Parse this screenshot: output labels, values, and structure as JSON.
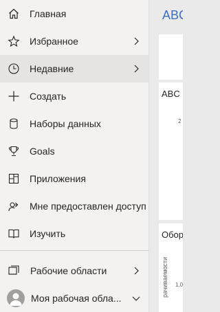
{
  "nav": {
    "items": [
      {
        "label": "Главная",
        "icon": "home-icon"
      },
      {
        "label": "Избранное",
        "icon": "star-icon",
        "has_chevron": true
      },
      {
        "label": "Недавние",
        "icon": "clock-icon",
        "has_chevron": true,
        "active": true
      },
      {
        "label": "Создать",
        "icon": "plus-icon"
      },
      {
        "label": "Наборы данных",
        "icon": "database-icon"
      },
      {
        "label": "Goals",
        "icon": "trophy-icon"
      },
      {
        "label": "Приложения",
        "icon": "apps-icon"
      },
      {
        "label": "Мне предоставлен доступ",
        "icon": "shared-with-me-icon"
      },
      {
        "label": "Изучить",
        "icon": "book-icon"
      }
    ],
    "workspaces_label": "Рабочие области",
    "my_workspace_label": "Моя рабочая обла..."
  },
  "content": {
    "title": "ABC",
    "card2_title": "ABC",
    "card2_tick": "2",
    "card3_title": "Обор",
    "card3_axis_label": "рачиваемости",
    "card3_tick": "1,0"
  },
  "colors": {
    "nav_bg": "#f3f2f1",
    "active_bg": "#e6e4e2",
    "title_blue": "#3b6fc2"
  }
}
